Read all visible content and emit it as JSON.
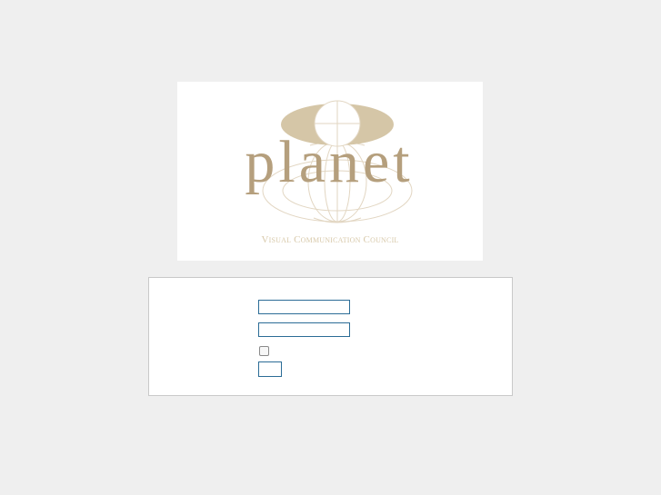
{
  "logo": {
    "wordmark": "planet",
    "tagline": "Visual Communication Council",
    "icon": "globe-emblem-icon",
    "colors": {
      "wordmark": "#b59f7d",
      "ellipse_fill": "#d5c6a7",
      "lines": "#e2d6c2",
      "tagline": "#d8c9aa"
    }
  },
  "login_form": {
    "username": {
      "value": "",
      "placeholder": ""
    },
    "password": {
      "value": "",
      "placeholder": ""
    },
    "remember_checked": false,
    "submit_label": "",
    "border_color": "#2b6c96"
  },
  "colors": {
    "page_background": "#efefef",
    "panel_border": "#c9c9c9"
  }
}
